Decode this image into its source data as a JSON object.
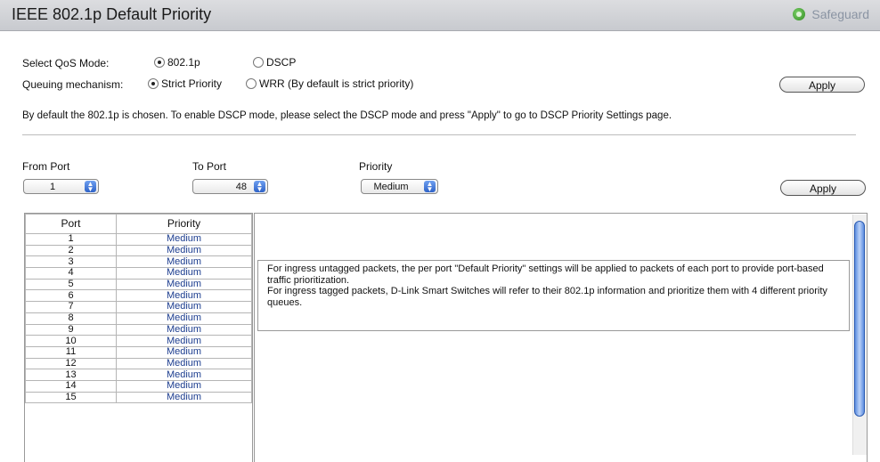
{
  "header": {
    "title": "IEEE 802.1p Default Priority",
    "safeguard_label": "Safeguard"
  },
  "qos_mode": {
    "label": "Select QoS Mode:",
    "options": [
      {
        "label": "802.1p",
        "selected": true
      },
      {
        "label": "DSCP",
        "selected": false
      }
    ]
  },
  "queuing": {
    "label": "Queuing mechanism:",
    "options": [
      {
        "label": "Strict Priority",
        "selected": true
      },
      {
        "label": "WRR (By default is strict priority)",
        "selected": false
      }
    ]
  },
  "apply_label": "Apply",
  "info_text": "By default the 802.1p is chosen. To enable DSCP mode, please select the DSCP mode and press \"Apply\" to go to DSCP Priority Settings page.",
  "port_settings": {
    "from_port": {
      "label": "From Port",
      "value": "1"
    },
    "to_port": {
      "label": "To Port",
      "value": "48"
    },
    "priority": {
      "label": "Priority",
      "value": "Medium"
    }
  },
  "table": {
    "headers": [
      "Port",
      "Priority"
    ],
    "rows": [
      {
        "port": "1",
        "priority": "Medium"
      },
      {
        "port": "2",
        "priority": "Medium"
      },
      {
        "port": "3",
        "priority": "Medium"
      },
      {
        "port": "4",
        "priority": "Medium"
      },
      {
        "port": "5",
        "priority": "Medium"
      },
      {
        "port": "6",
        "priority": "Medium"
      },
      {
        "port": "7",
        "priority": "Medium"
      },
      {
        "port": "8",
        "priority": "Medium"
      },
      {
        "port": "9",
        "priority": "Medium"
      },
      {
        "port": "10",
        "priority": "Medium"
      },
      {
        "port": "11",
        "priority": "Medium"
      },
      {
        "port": "12",
        "priority": "Medium"
      },
      {
        "port": "13",
        "priority": "Medium"
      },
      {
        "port": "14",
        "priority": "Medium"
      },
      {
        "port": "15",
        "priority": "Medium"
      }
    ]
  },
  "note_lines": [
    "For ingress untagged packets, the per port \"Default Priority\" settings will be applied to packets of each port to provide port-based traffic prioritization.",
    "For ingress tagged packets, D-Link Smart Switches will refer to their 802.1p information and prioritize them with 4 different priority queues."
  ]
}
